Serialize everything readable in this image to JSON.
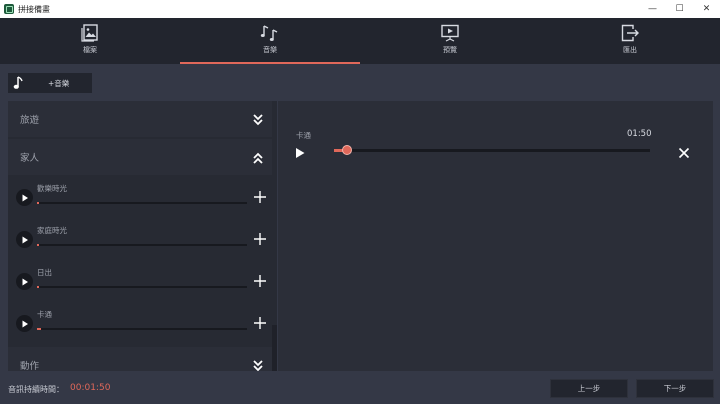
{
  "window": {
    "title": "拼接備畫",
    "controls": [
      "—",
      "☐",
      "✕"
    ]
  },
  "nav": {
    "tabs": [
      {
        "label": "檔案",
        "icon": "file-image-icon",
        "active": false
      },
      {
        "label": "音樂",
        "icon": "music-notes-icon",
        "active": true
      },
      {
        "label": "預覽",
        "icon": "preview-screen-icon",
        "active": false
      },
      {
        "label": "匯出",
        "icon": "export-icon",
        "active": false
      }
    ]
  },
  "toolbar": {
    "add_music_label": "+音樂",
    "add_music_icon": "music-note-icon"
  },
  "library": {
    "categories": [
      {
        "label": "旅遊",
        "expanded": false
      },
      {
        "label": "家人",
        "expanded": true
      },
      {
        "label": "動作",
        "expanded": false
      }
    ],
    "tracks": [
      {
        "name": "歡樂時光",
        "progress": 0.01
      },
      {
        "name": "家庭時光",
        "progress": 0.01
      },
      {
        "name": "日出",
        "progress": 0.01
      },
      {
        "name": "卡通",
        "progress": 0.02
      }
    ]
  },
  "selected": {
    "name": "卡通",
    "duration": "01:50",
    "progress": 0.04
  },
  "footer": {
    "duration_label": "音訊持續時間：",
    "duration_value": "00:01:50",
    "prev_label": "上一步",
    "next_label": "下一步"
  },
  "colors": {
    "accent": "#e0685a",
    "background": "#343846",
    "panel": "#2b2e38",
    "nav": "#22252e"
  }
}
